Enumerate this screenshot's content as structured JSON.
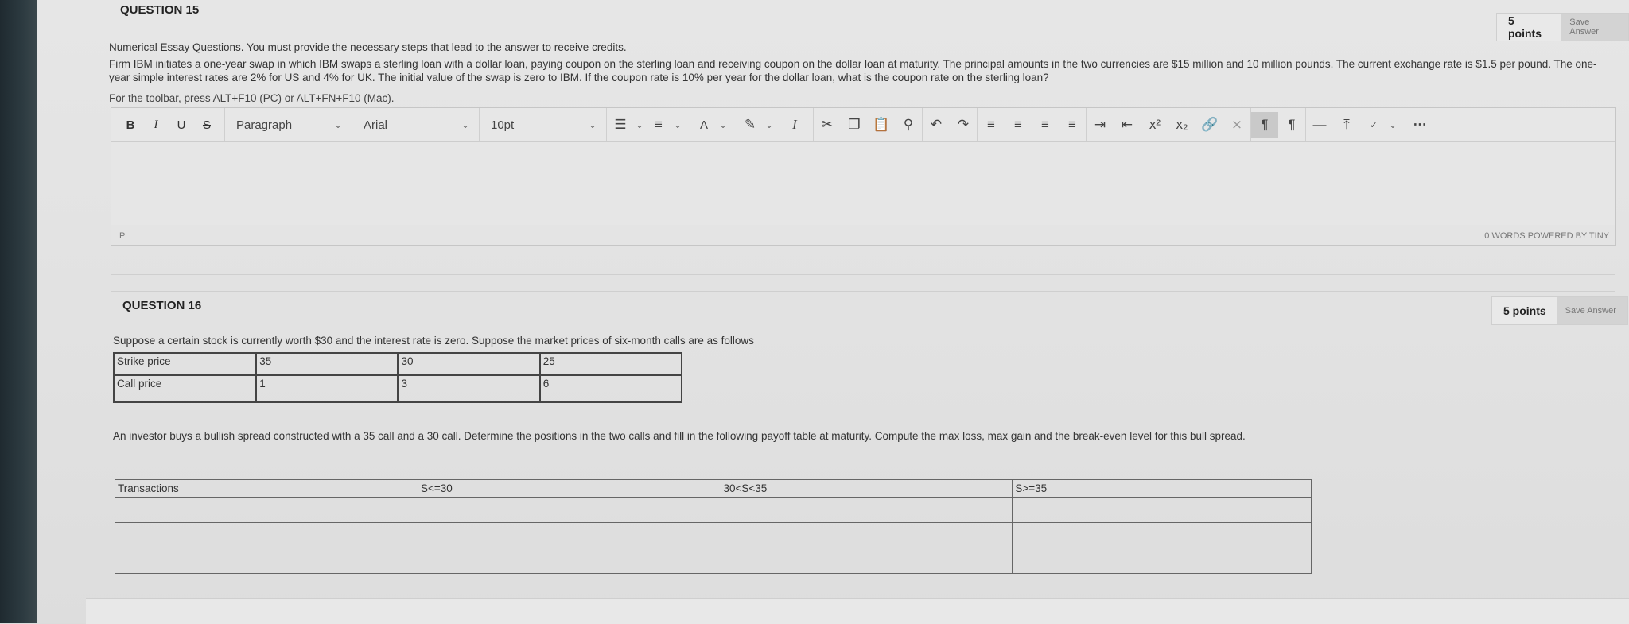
{
  "q15": {
    "title": "QUESTION 15",
    "points": "5 points",
    "save": "Save Answer",
    "instructions": "Numerical Essay Questions. You must provide the necessary steps that lead to the answer to receive credits.",
    "body": "Firm IBM initiates a one-year swap in which IBM swaps a sterling loan with a dollar loan, paying coupon on the sterling loan and receiving coupon on the dollar loan at maturity. The principal amounts in the two currencies are $15 million and 10 million pounds. The current exchange rate is $1.5 per pound. The one-year simple interest rates are 2% for US and 4% for UK. The initial value of the swap is zero to IBM. If the coupon rate is 10% per year for the dollar loan, what is the coupon rate on the sterling loan?",
    "toolbar_hint": "For the toolbar, press ALT+F10 (PC) or ALT+FN+F10 (Mac)."
  },
  "editor": {
    "bold": "B",
    "italic": "I",
    "underline": "U",
    "strike": "S",
    "block_format": "Paragraph",
    "font_family": "Arial",
    "font_size": "10pt",
    "status_path": "P",
    "word_count": "0 WORDS",
    "powered_by": "POWERED BY TINY"
  },
  "q16": {
    "title": "QUESTION 16",
    "points": "5 points",
    "save": "Save Answer",
    "intro": "Suppose a certain stock is currently worth $30 and the interest rate is zero. Suppose the market prices of six-month calls are as follows",
    "price_table": {
      "rows": [
        [
          "Strike price",
          "35",
          "30",
          "25"
        ],
        [
          "Call price",
          "1",
          "3",
          "6"
        ]
      ]
    },
    "task": "An investor buys a bullish spread constructed with a 35 call and a 30 call. Determine the positions in the two calls and fill in the following payoff table at maturity. Compute the max loss, max gain and the break-even level for this bull spread.",
    "payoff_table": {
      "headers": [
        "Transactions",
        "S<=30",
        "30<S<35",
        "S>=35"
      ],
      "empty_rows": 3
    }
  }
}
